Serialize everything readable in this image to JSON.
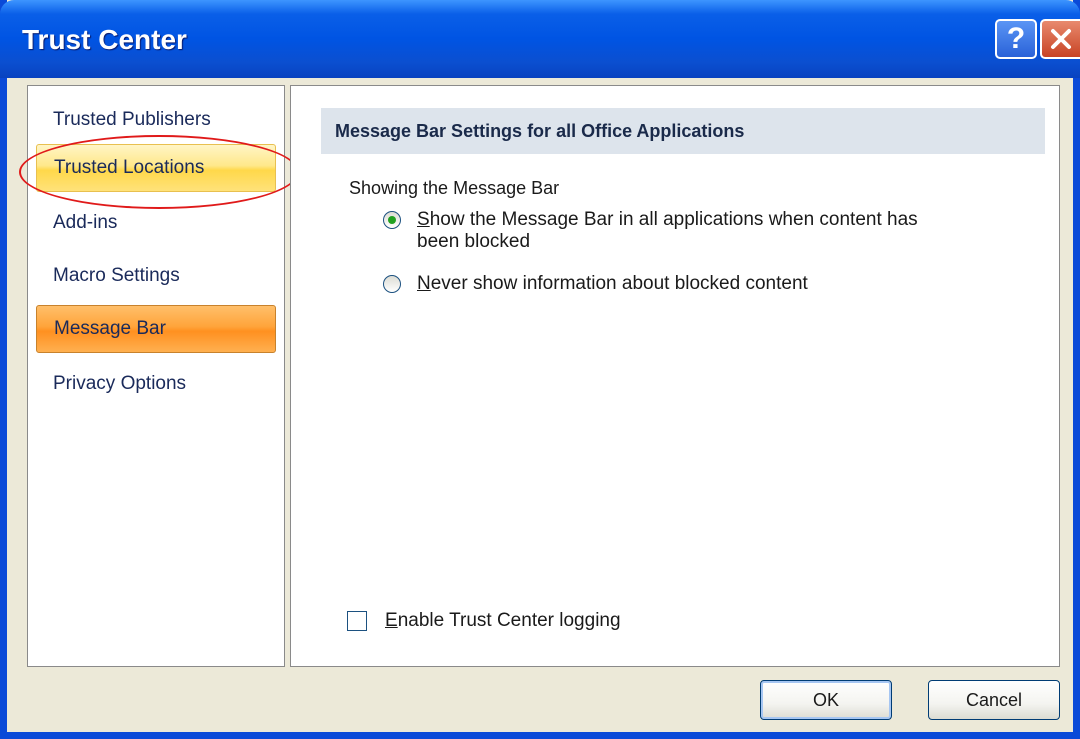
{
  "window": {
    "title": "Trust Center"
  },
  "nav": {
    "items": [
      {
        "label": "Trusted Publishers"
      },
      {
        "label": "Trusted Locations"
      },
      {
        "label": "Add-ins"
      },
      {
        "label": "Macro Settings"
      },
      {
        "label": "Message Bar"
      },
      {
        "label": "Privacy Options"
      }
    ],
    "selected": "Message Bar",
    "hovered": "Trusted Locations"
  },
  "content": {
    "section_header": "Message Bar Settings for all Office Applications",
    "group_label": "Showing the Message Bar",
    "options": [
      {
        "accel": "S",
        "rest": "how the Message Bar in all applications when content has",
        "line2": "been blocked",
        "selected": true
      },
      {
        "accel": "N",
        "rest": "ever show information about blocked content",
        "line2": "",
        "selected": false
      }
    ],
    "logging": {
      "accel": "E",
      "rest": "nable Trust Center logging",
      "checked": false
    }
  },
  "buttons": {
    "ok": "OK",
    "cancel": "Cancel"
  },
  "colors": {
    "titlebar": "#0054e3",
    "nav_active": "#ffa43a",
    "nav_hover": "#ffe88a",
    "annotation": "#e01a1a"
  }
}
